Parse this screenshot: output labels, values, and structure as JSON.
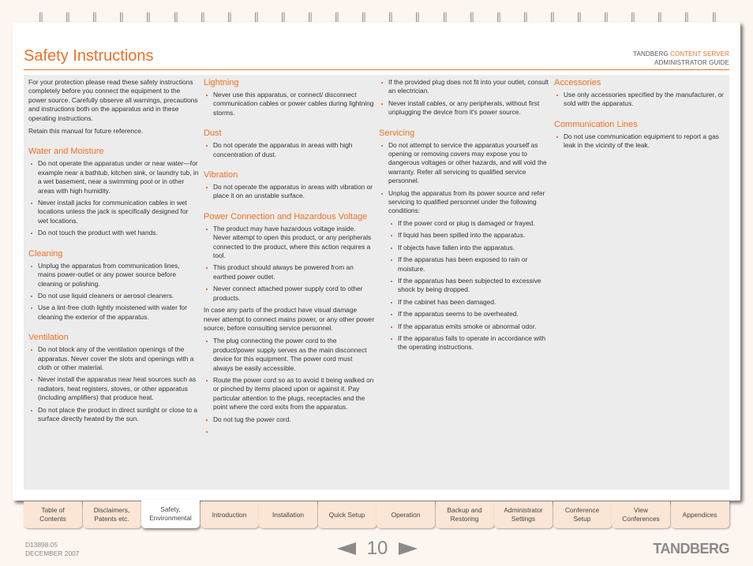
{
  "header": {
    "title": "Safety Instructions",
    "brand_prefix": "TANDBERG ",
    "brand_accent": "CONTENT SERVER",
    "guide": "ADMINISTRATOR GUIDE"
  },
  "colors": {
    "accent": "#ec7125",
    "panel": "#ececec",
    "tab": "#fbe5d4",
    "background": "#fdf5ef"
  },
  "column1": {
    "intro": "For your protection please read these safety instructions completely before you connect the equipment to the power source. Carefully observe all warnings, precautions and instructions both on the apparatus and in these operating instructions.",
    "retain": "Retain this manual for future reference.",
    "water": {
      "heading": "Water and Moisture",
      "items": [
        "Do not operate the apparatus under or near water—for example near a bathtub, kitchen sink, or laundry tub, in a wet basement, near a swimming pool or in other areas with high humidity.",
        "Never install jacks for communication cables in wet locations unless the jack is specifically designed for wet locations.",
        "Do not touch the product with wet hands."
      ]
    },
    "cleaning": {
      "heading": "Cleaning",
      "items": [
        "Unplug the apparatus from communication lines, mains power-outlet or any power source before cleaning or polishing.",
        "Do not use liquid cleaners or aerosol cleaners.",
        "Use a lint-free cloth lightly moistened with water for cleaning the exterior of the apparatus."
      ]
    },
    "ventilation": {
      "heading": "Ventilation",
      "items": [
        "Do not block any of the ventilation openings of the apparatus. Never cover the slots and openings with a cloth or other material.",
        "Never install the apparatus near heat sources such as radiators, heat registers, stoves, or other apparatus (including amplifiers) that produce heat.",
        "Do not place the product in direct sunlight or close to a surface directly heated by the sun."
      ]
    }
  },
  "column2": {
    "lightning": {
      "heading": "Lightning",
      "items": [
        "Never use this apparatus, or connect/ disconnect communication cables or power cables during lightning storms."
      ]
    },
    "dust": {
      "heading": "Dust",
      "items": [
        "Do not operate the apparatus in areas with high concentration of dust."
      ]
    },
    "vibration": {
      "heading": "Vibration",
      "items": [
        "Do not operate the apparatus in areas with vibration or place it on an unstable surface."
      ]
    },
    "power": {
      "heading": "Power Connection and Hazardous Voltage",
      "items": [
        "The product may have hazardous voltage inside. Never attempt to open this product, or any peripherals connected to the product, where this action requires a tool.",
        "This product should always be powered from an earthed power outlet.",
        "Never connect attached power supply cord to other products."
      ],
      "paragraph": "In case any parts of the product have visual damage never attempt to connect mains power, or any other power source, before consulting service personnel.",
      "items2": [
        "The plug connecting the power cord to the product/power supply serves as the main disconnect device for this equipment. The power cord must always be easily accessible.",
        "Route the power cord so as to avoid it being walked on or pinched by items placed upon or against it. Pay particular attention to the plugs, receptacles and the point where the cord exits from the apparatus.",
        "Do not tug the power cord.",
        ""
      ]
    }
  },
  "column3": {
    "power_cont": [
      "If the provided plug does not fit into your outlet, consult an electrician.",
      "Never install cables, or any peripherals, without first unplugging the device from it's power source."
    ],
    "servicing": {
      "heading": "Servicing",
      "items": [
        "Do not attempt to service the apparatus yourself as opening or removing covers may expose you to dangerous voltages or other hazards, and will void the warranty. Refer all servicing to qualified service personnel.",
        "Unplug the apparatus from its power source and refer servicing to qualified personnel under the following conditions:"
      ],
      "conditions": [
        "If the power cord or plug is damaged or frayed.",
        "If liquid has been spilled into the apparatus.",
        "If objects have fallen into the apparatus.",
        "If the apparatus has been exposed to rain or moisture.",
        "If the apparatus has been subjected to excessive shock by being dropped.",
        "If the cabinet has been damaged.",
        "If the apparatus seems to be overheated.",
        "If the apparatus emits smoke or abnormal odor.",
        "If the apparatus fails to operate in accordance with the operating instructions."
      ]
    }
  },
  "column4": {
    "accessories": {
      "heading": "Accessories",
      "items": [
        "Use only accessories specified by the manufacturer, or sold with the apparatus."
      ]
    },
    "communication": {
      "heading": "Communication Lines",
      "items": [
        "Do not use communication equipment to report a gas leak in the vicinity of the leak."
      ]
    }
  },
  "tabs": [
    {
      "line1": "Table of",
      "line2": "Contents",
      "active": false
    },
    {
      "line1": "Disclaimers,",
      "line2": "Patents etc.",
      "active": false
    },
    {
      "line1": "Safety,",
      "line2": "Environmental",
      "active": true
    },
    {
      "line1": "Introduction",
      "line2": "",
      "active": false
    },
    {
      "line1": "Installation",
      "line2": "",
      "active": false
    },
    {
      "line1": "Quick Setup",
      "line2": "",
      "active": false
    },
    {
      "line1": "Operation",
      "line2": "",
      "active": false
    },
    {
      "line1": "Backup and",
      "line2": "Restoring",
      "active": false
    },
    {
      "line1": "Administrator",
      "line2": "Settings",
      "active": false
    },
    {
      "line1": "Conference",
      "line2": "Setup",
      "active": false
    },
    {
      "line1": "View",
      "line2": "Conferences",
      "active": false
    },
    {
      "line1": "Appendices",
      "line2": "",
      "active": false
    }
  ],
  "footer": {
    "doc_number": "D13898.05",
    "date": "DECEMBER 2007",
    "page_number": "10",
    "logo": "TANDBERG",
    "prev_icon": "arrow-left-icon",
    "next_icon": "arrow-right-icon"
  }
}
